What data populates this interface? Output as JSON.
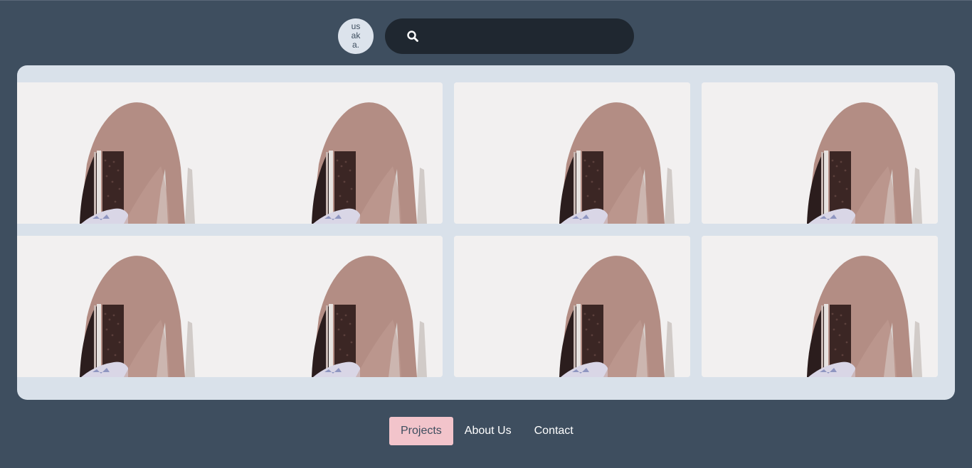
{
  "brand": {
    "logo_text": "usaka.",
    "icon": "logo-icon"
  },
  "search": {
    "placeholder": "",
    "value": "",
    "icon": "search-icon"
  },
  "gallery": {
    "tiles": [
      {
        "image": "arch-doorway-photo"
      },
      {
        "image": "arch-doorway-photo"
      },
      {
        "image": "arch-doorway-photo"
      },
      {
        "image": "arch-doorway-photo"
      },
      {
        "image": "arch-doorway-photo"
      },
      {
        "image": "arch-doorway-photo"
      },
      {
        "image": "arch-doorway-photo"
      },
      {
        "image": "arch-doorway-photo"
      }
    ]
  },
  "nav": {
    "items": [
      {
        "label": "Projects",
        "active": true
      },
      {
        "label": "About Us",
        "active": false
      },
      {
        "label": "Contact",
        "active": false
      }
    ]
  },
  "colors": {
    "page_background": "#3e4e5f",
    "search_background": "#1f2730",
    "gallery_background": "#d9e1ea",
    "active_nav": "#f2c4cb"
  }
}
